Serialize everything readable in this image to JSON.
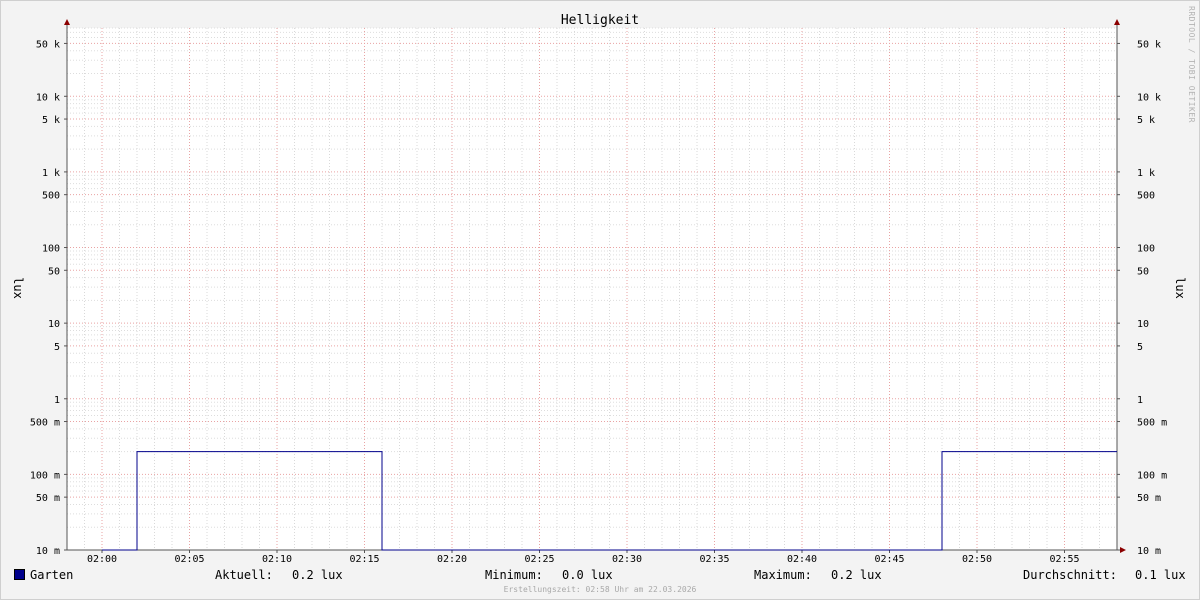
{
  "chart_data": {
    "type": "line",
    "title": "Helligkeit",
    "ylabel": "lux",
    "ylabel_right": "lux",
    "yscale": "log",
    "ylim": [
      0.01,
      80000
    ],
    "x_tick_labels": [
      "02:00",
      "02:05",
      "02:10",
      "02:15",
      "02:20",
      "02:25",
      "02:30",
      "02:35",
      "02:40",
      "02:45",
      "02:50",
      "02:55"
    ],
    "x_minute_range": [
      -2,
      58
    ],
    "y_tick_labels": [
      {
        "value": 50000,
        "label": "50 k"
      },
      {
        "value": 10000,
        "label": "10 k"
      },
      {
        "value": 5000,
        "label": "5 k"
      },
      {
        "value": 1000,
        "label": "1 k"
      },
      {
        "value": 500,
        "label": "500"
      },
      {
        "value": 100,
        "label": "100"
      },
      {
        "value": 50,
        "label": "50"
      },
      {
        "value": 10,
        "label": "10"
      },
      {
        "value": 5,
        "label": "5"
      },
      {
        "value": 1,
        "label": "1"
      },
      {
        "value": 0.5,
        "label": "500 m"
      },
      {
        "value": 0.1,
        "label": "100 m"
      },
      {
        "value": 0.05,
        "label": "50 m"
      },
      {
        "value": 0.01,
        "label": "10 m"
      }
    ],
    "series": [
      {
        "name": "Garten",
        "color": "#00008b",
        "points": [
          {
            "t": "02:00",
            "v": 0.0
          },
          {
            "t": "02:02",
            "v": 0.0
          },
          {
            "t": "02:02",
            "v": 0.2
          },
          {
            "t": "02:16",
            "v": 0.2
          },
          {
            "t": "02:16",
            "v": 0.0
          },
          {
            "t": "02:48",
            "v": 0.0
          },
          {
            "t": "02:48",
            "v": 0.2
          },
          {
            "t": "02:58",
            "v": 0.2
          }
        ]
      }
    ],
    "grid": true,
    "legend_position": "bottom"
  },
  "legend": {
    "series_name": "Garten",
    "series_color": "#00008b",
    "current_label": "Aktuell:",
    "current_value": "0.2 lux",
    "min_label": "Minimum:",
    "min_value": "0.0 lux",
    "max_label": "Maximum:",
    "max_value": "0.2 lux",
    "avg_label": "Durchschnitt:",
    "avg_value": "0.1 lux"
  },
  "footer": "Erstellungszeit: 02:58 Uhr am 22.03.2026",
  "watermark": "RRDTOOL / TOBI OETIKER"
}
